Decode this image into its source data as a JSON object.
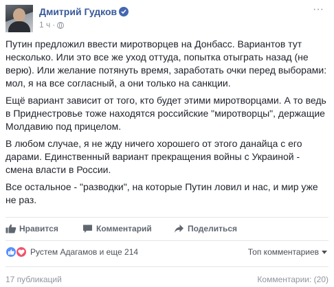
{
  "post": {
    "author": "Дмитрий Гудков",
    "time": "1 ч",
    "dot": "·",
    "more": "···",
    "paragraphs": [
      "Путин предложил ввести миротворцев на Донбасс. Вариантов тут несколько. Или это все же уход оттуда, попытка отыграть назад (не верю). Или желание потянуть время, заработать очки перед выборами: мол, я на все согласный, а они только на санкции.",
      "Ещё вариант зависит от того, кто будет этими миротворцами. А то ведь в Приднестровье тоже находятся российские \"миротворцы\", держащие Молдавию под прицелом.",
      "В любом случае, я не жду ничего хорошего от этого данайца с его дарами. Единственный вариант прекращения войны с Украиной - смена власти в России.",
      "Все остальное - \"разводки\", на которые Путин ловил и нас, и мир уже не раз."
    ]
  },
  "actions": {
    "like": "Нравится",
    "comment": "Комментарий",
    "share": "Поделиться"
  },
  "reactions": {
    "text": "Рустем Адагамов и еще 214",
    "top_comments": "Топ комментариев"
  },
  "footer": {
    "shares": "17 публикаций",
    "comments": "Комментарии: (20)"
  },
  "colors": {
    "link": "#365899",
    "like_blue": "#5890ff",
    "love_red": "#f25268",
    "muted": "#90949c"
  }
}
